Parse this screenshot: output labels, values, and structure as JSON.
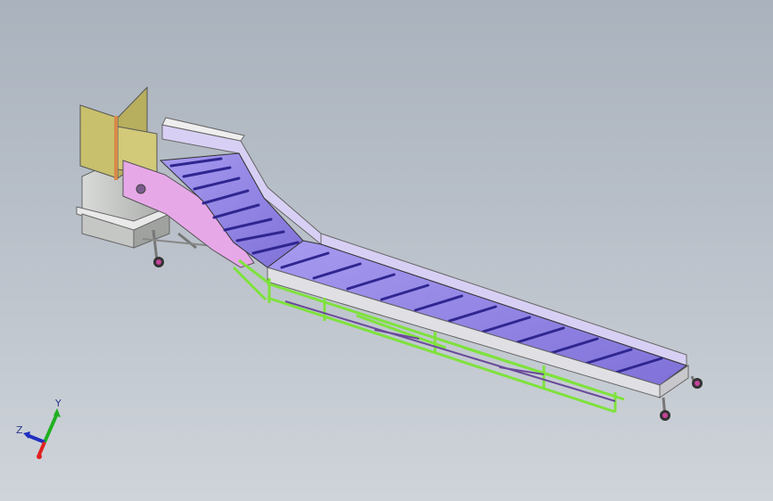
{
  "viewport": {
    "background_top": "#aab2bd",
    "background_bottom": "#cfd4da"
  },
  "model": {
    "description_icon": "conveyor-3d-model"
  },
  "colors": {
    "belt": "#8c7fe0",
    "belt_slat": "#3a2f9e",
    "side_panel": "#e7a8e8",
    "side_panel_light": "#d8d0f4",
    "frame": "#7ee23c",
    "hopper": "#b8bbb8",
    "shield": "#c8c06c",
    "caster": "#c5449a"
  },
  "triad": {
    "x_label": "",
    "y_label": "Y",
    "z_label": "Z",
    "x_color": "#e02020",
    "y_color": "#20b020",
    "z_color": "#2030c0"
  }
}
